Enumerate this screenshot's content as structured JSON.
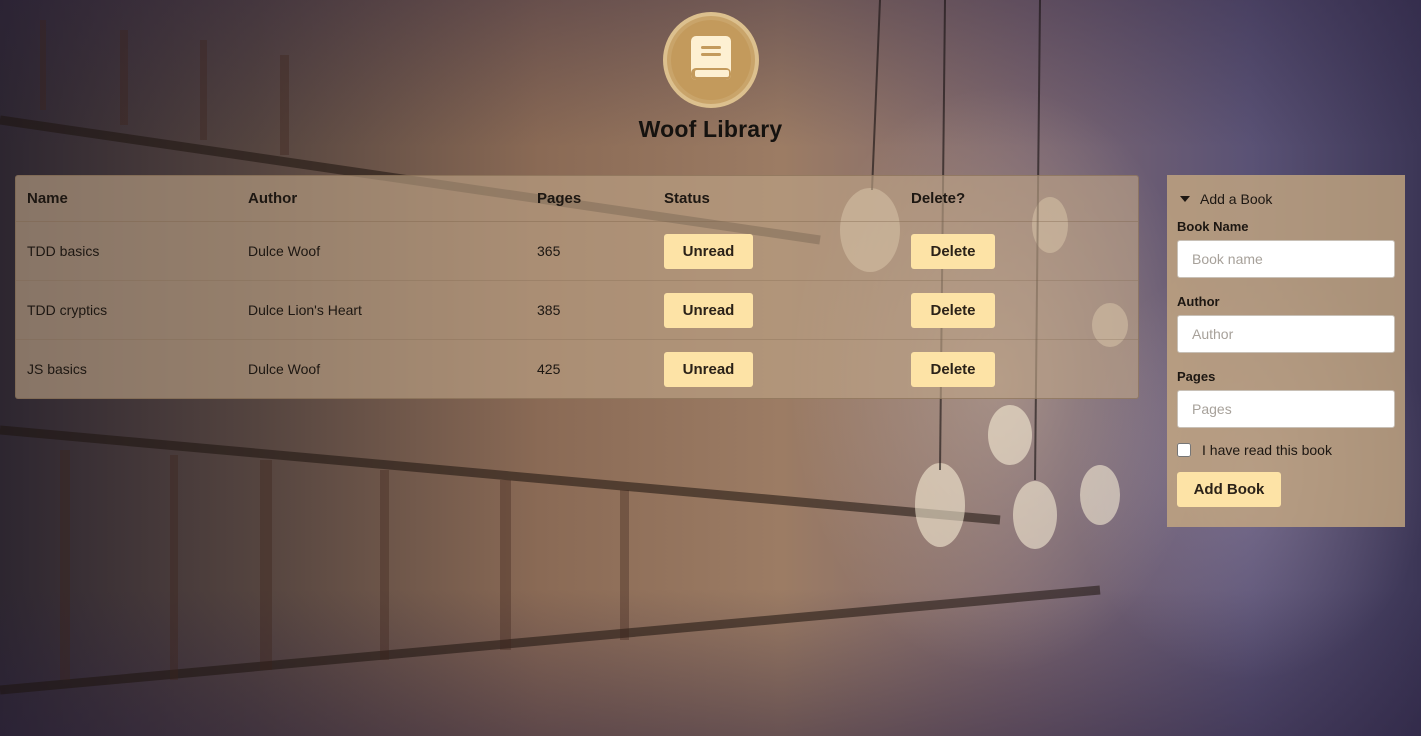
{
  "header": {
    "logo_icon": "book-icon",
    "title": "Woof Library"
  },
  "table": {
    "columns": [
      "Name",
      "Author",
      "Pages",
      "Status",
      "Delete?"
    ],
    "rows": [
      {
        "name": "TDD basics",
        "author": "Dulce Woof",
        "pages": "365",
        "status": "Unread",
        "delete": "Delete"
      },
      {
        "name": "TDD cryptics",
        "author": "Dulce Lion's Heart",
        "pages": "385",
        "status": "Unread",
        "delete": "Delete"
      },
      {
        "name": "JS basics",
        "author": "Dulce Woof",
        "pages": "425",
        "status": "Unread",
        "delete": "Delete"
      }
    ]
  },
  "form": {
    "summary": "Add a Book",
    "book_name_label": "Book Name",
    "book_name_placeholder": "Book name",
    "author_label": "Author",
    "author_placeholder": "Author",
    "pages_label": "Pages",
    "pages_placeholder": "Pages",
    "read_checkbox_label": "I have read this book",
    "read_checked": false,
    "submit_label": "Add Book"
  },
  "colors": {
    "button_bg": "#fde3a6",
    "logo_bg": "#c9a46a"
  }
}
